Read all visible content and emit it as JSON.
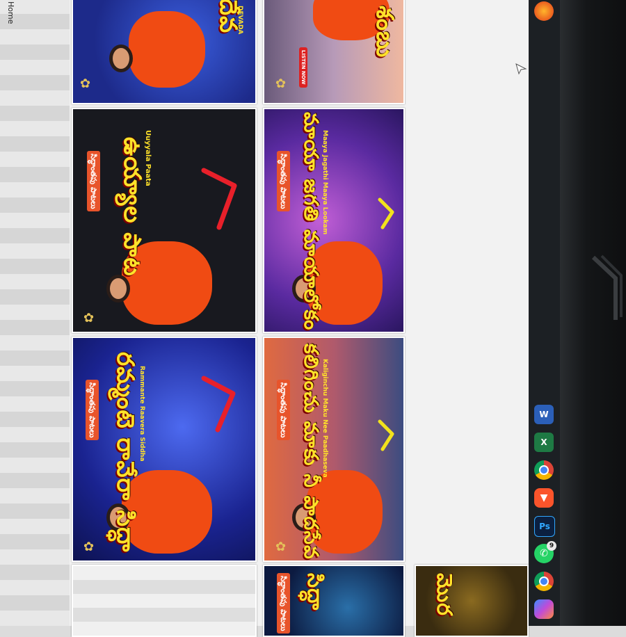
{
  "browser": {
    "home_label": "Home"
  },
  "thumbnails": [
    {
      "id": "t1",
      "title": "దేవ",
      "subtitle": "DEVADA",
      "theme": "blue"
    },
    {
      "id": "t2",
      "title": "శంబు",
      "subtitle": "",
      "theme": "sunset"
    },
    {
      "id": "t3",
      "title": "ఉయ్యాల పాట",
      "subtitle": "Uuyyala Paata",
      "tag": "సిద్ధాంతపు పాటలు",
      "theme": "black",
      "checked": true
    },
    {
      "id": "t4",
      "title": "మాయా జగతి మాయాలోకం",
      "subtitle": "Maaya Jagathi Maaya Lookam",
      "tag": "సిద్ధాంతపు పాటలు",
      "theme": "purple",
      "checked": true
    },
    {
      "id": "t5",
      "title": "రమ్మంటె రావేరా సిద్ధా",
      "subtitle": "Rammante Raavera Siddha",
      "tag": "సిద్ధాంతపు పాటలు",
      "theme": "blue",
      "checked": true
    },
    {
      "id": "t6",
      "title": "కలిగించు మాకు నీ పాదసేవ",
      "subtitle": "Kaliginchu Maku Nee Paadhaseva",
      "tag": "సిద్ధాంతపు పాటలు",
      "theme": "sunset",
      "checked": true
    },
    {
      "id": "t7",
      "title": "సిద్ధా",
      "subtitle": "",
      "tag": "సిద్ధాంతపు పాటలు",
      "theme": "cosmic"
    },
    {
      "id": "t8",
      "title": "మొర",
      "subtitle": "",
      "tag": "",
      "theme": "gold"
    }
  ],
  "taskbar": {
    "icons": [
      {
        "name": "firefox-icon",
        "label": ""
      },
      {
        "name": "word-icon",
        "label": "W"
      },
      {
        "name": "excel-icon",
        "label": "X"
      },
      {
        "name": "chrome-icon",
        "label": ""
      },
      {
        "name": "brave-icon",
        "label": ""
      },
      {
        "name": "photoshop-icon",
        "label": "Ps"
      },
      {
        "name": "whatsapp-icon",
        "label": "",
        "badge": "9"
      },
      {
        "name": "chrome-alt-icon",
        "label": ""
      },
      {
        "name": "copilot-icon",
        "label": ""
      }
    ]
  },
  "colors": {
    "title_yellow": "#ffe22a",
    "robe_orange": "#f04b13",
    "check_red": "#e8202a",
    "check_yellow": "#f2e21c",
    "taskbar_bg": "#1c2024"
  }
}
